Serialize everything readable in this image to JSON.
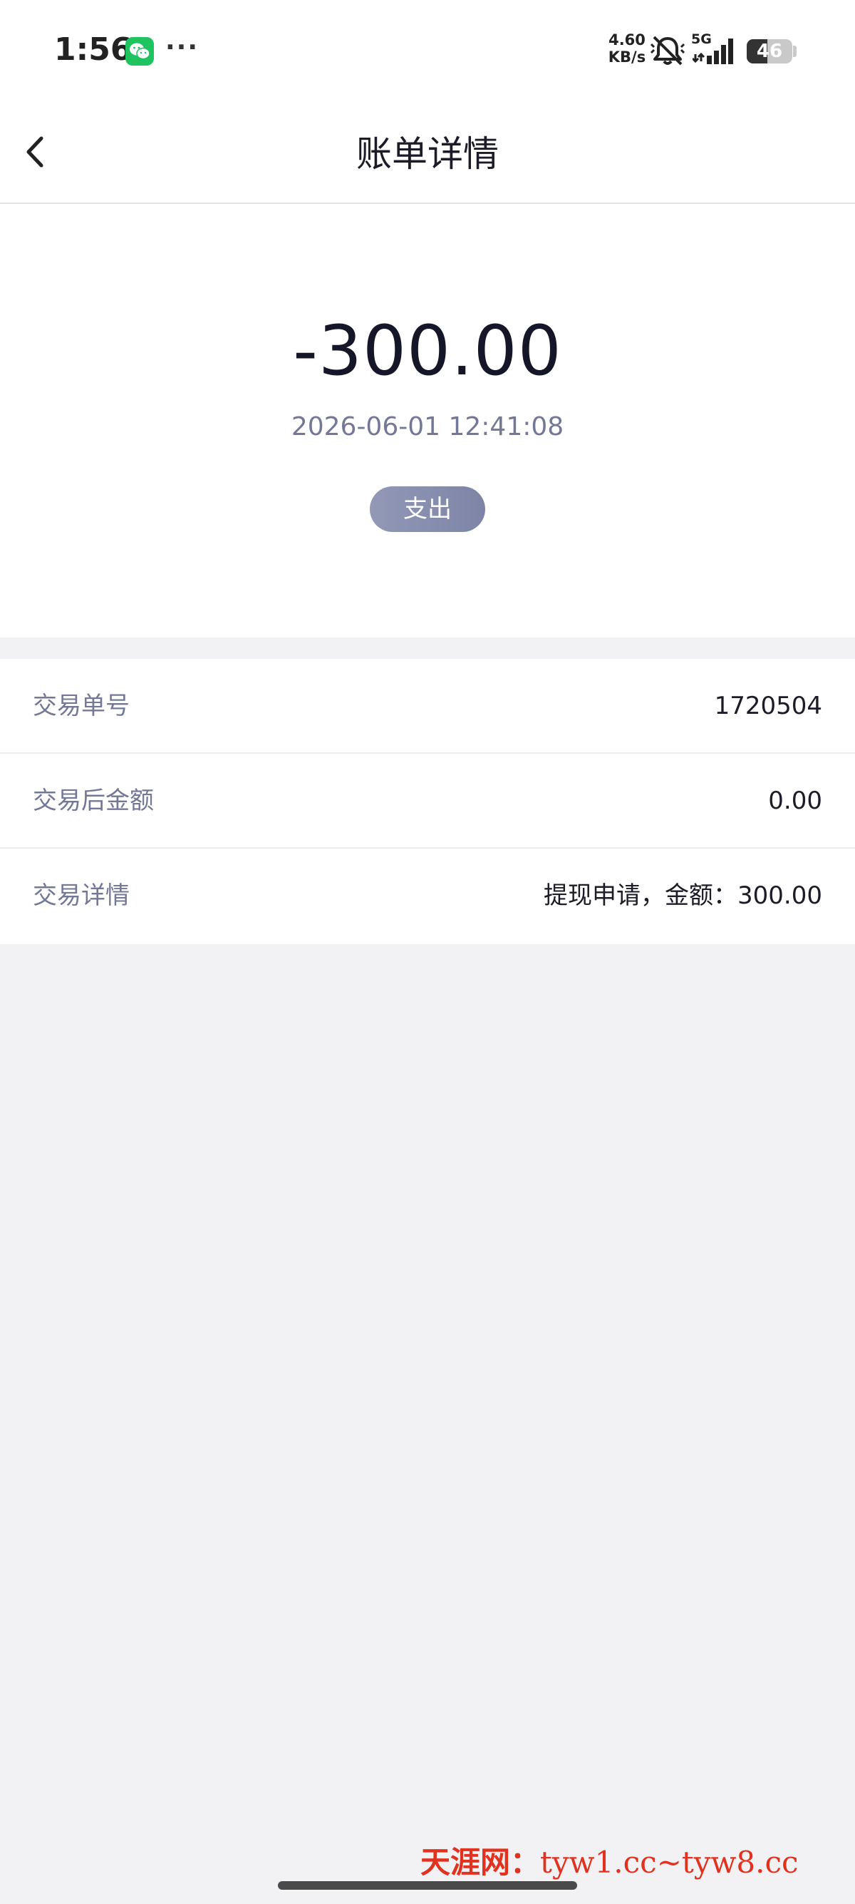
{
  "status_bar": {
    "time": "1:56",
    "dots": "···",
    "net_speed_value": "4.60",
    "net_speed_unit": "KB/s",
    "signal_label": "5G",
    "battery_level": "46",
    "battery_fraction": 0.46
  },
  "header": {
    "title": "账单详情"
  },
  "summary": {
    "amount": "-300.00",
    "datetime": "2026-06-01 12:41:08",
    "type_label": "支出"
  },
  "details": [
    {
      "label": "交易单号",
      "value": "1720504"
    },
    {
      "label": "交易后金额",
      "value": "0.00"
    },
    {
      "label": "交易详情",
      "value": "提现申请，金额：300.00"
    }
  ],
  "watermark": {
    "brand": "天涯网：",
    "domains": "tyw1.cc~tyw8.cc"
  },
  "colors": {
    "accent_badge": "#878daf",
    "wechat": "#1fc360",
    "watermark": "#e0321f"
  }
}
